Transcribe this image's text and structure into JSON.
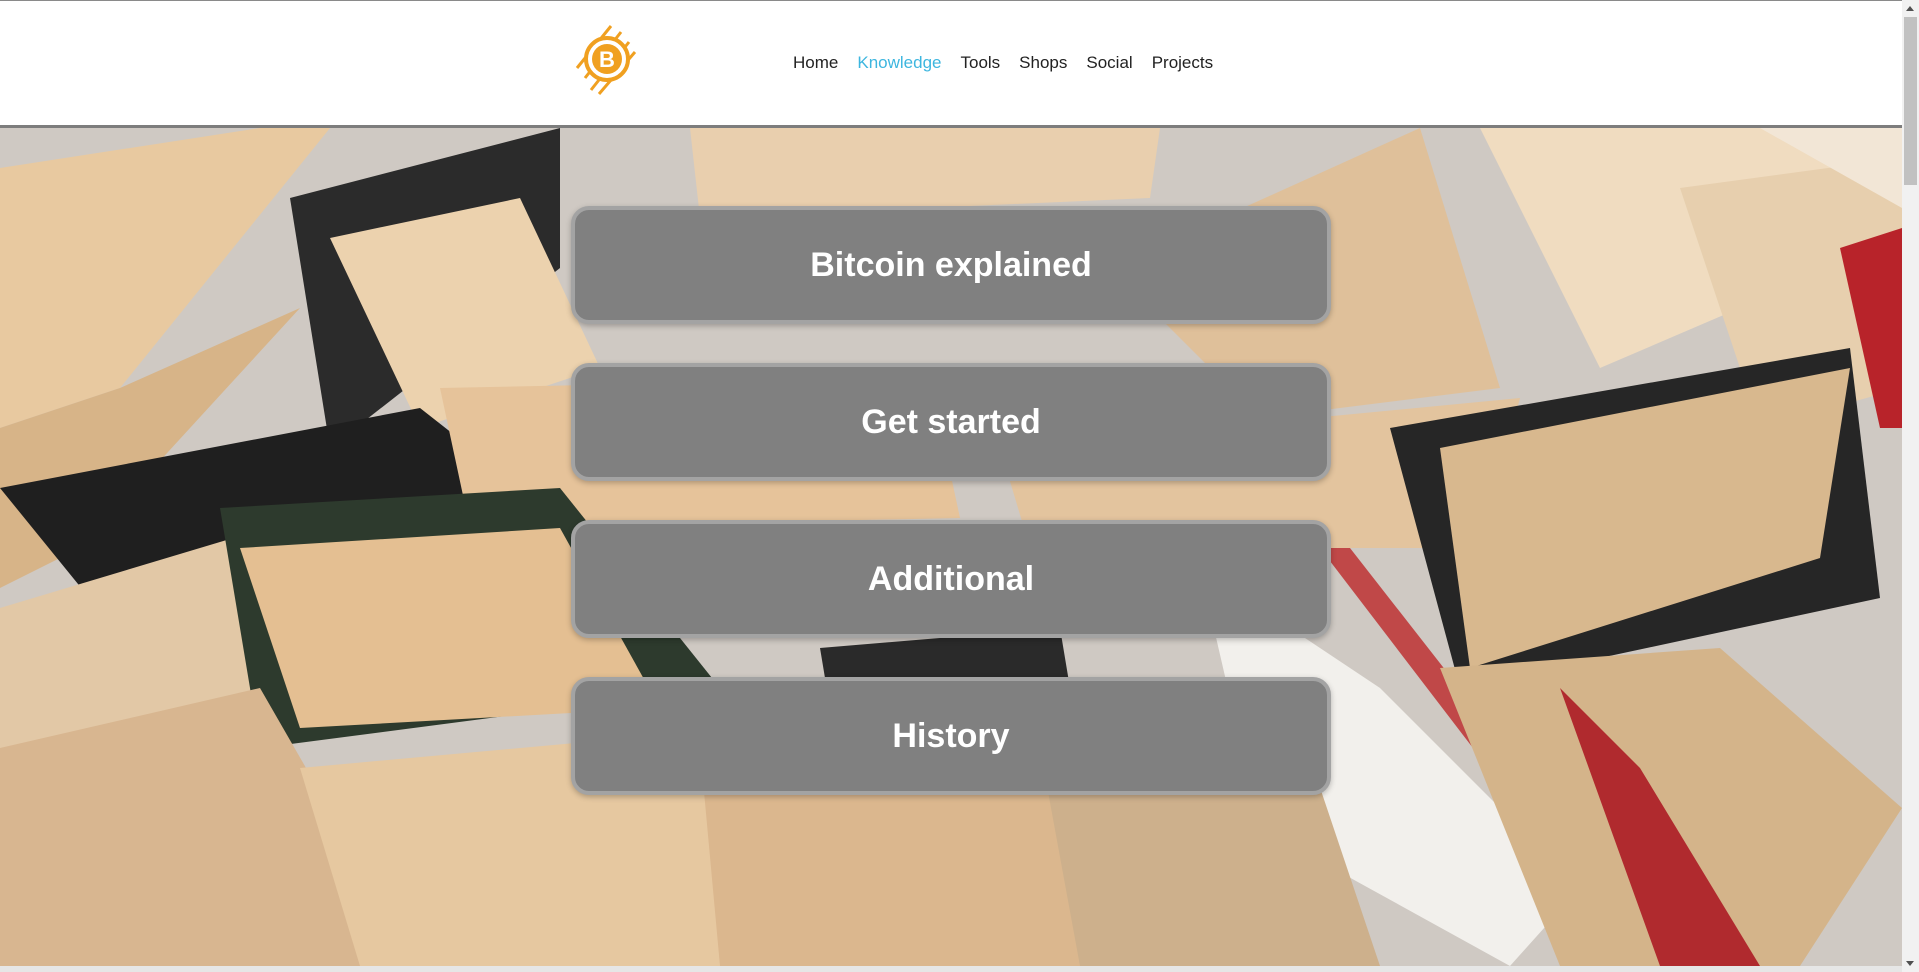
{
  "header": {
    "logo_icon": "bitcoin-logo-icon",
    "accent_color": "#3db6df",
    "logo_color": "#f0a020"
  },
  "nav": {
    "items": [
      {
        "label": "Home",
        "active": false
      },
      {
        "label": "Knowledge",
        "active": true
      },
      {
        "label": "Tools",
        "active": false
      },
      {
        "label": "Shops",
        "active": false
      },
      {
        "label": "Social",
        "active": false
      },
      {
        "label": "Projects",
        "active": false
      }
    ]
  },
  "hero": {
    "background": "books-photo",
    "buttons": [
      {
        "label": "Bitcoin explained"
      },
      {
        "label": "Get started"
      },
      {
        "label": "Additional"
      },
      {
        "label": "History"
      }
    ]
  }
}
